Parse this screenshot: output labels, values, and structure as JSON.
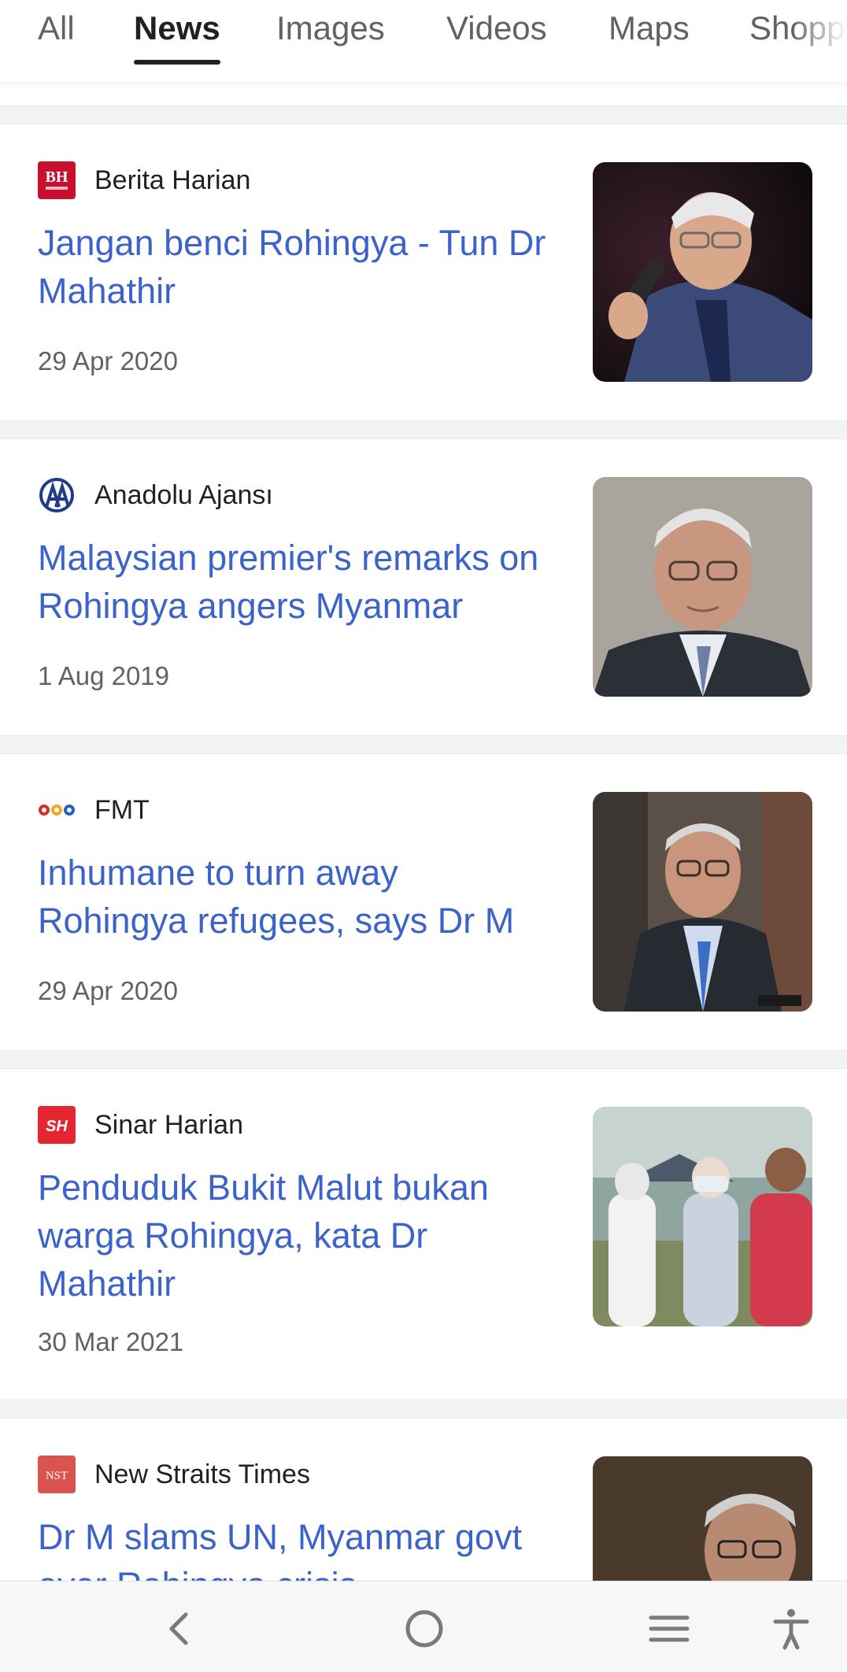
{
  "tabs": [
    {
      "label": "All"
    },
    {
      "label": "News",
      "active": true
    },
    {
      "label": "Images"
    },
    {
      "label": "Videos"
    },
    {
      "label": "Maps"
    },
    {
      "label": "Shopp"
    }
  ],
  "results": [
    {
      "source": "Berita Harian",
      "logo_text": "BH",
      "logo_color": "#c8102e",
      "headline": "Jangan benci Rohingya - Tun Dr Mahathir",
      "date": "29 Apr 2020"
    },
    {
      "source": "Anadolu Ajansı",
      "logo_text": "AA",
      "logo_color": "#1f3c88",
      "headline": "Malaysian premier's remarks on Rohingya angers Myanmar",
      "date": "1 Aug 2019"
    },
    {
      "source": "FMT",
      "logo_text": "",
      "logo_color": "#d32f2f",
      "headline": "Inhumane to turn away Rohingya refugees, says Dr M",
      "date": "29 Apr 2020"
    },
    {
      "source": "Sinar Harian",
      "logo_text": "SH",
      "logo_color": "#e3262f",
      "headline": "Penduduk Bukit Malut bukan warga Rohingya, kata Dr Mahathir",
      "date": "30 Mar 2021"
    },
    {
      "source": "New Straits Times",
      "logo_text": "NST",
      "logo_color": "#d9534f",
      "headline": "Dr M slams UN, Myanmar govt over Rohingya crisis",
      "date": ""
    }
  ],
  "colors": {
    "headline": "#3c63c9",
    "separator": "#f1f3f4",
    "active_tab": "#202124"
  },
  "navbar": {
    "icons": [
      "back-icon",
      "home-icon",
      "menu-icon",
      "accessibility-icon"
    ]
  }
}
